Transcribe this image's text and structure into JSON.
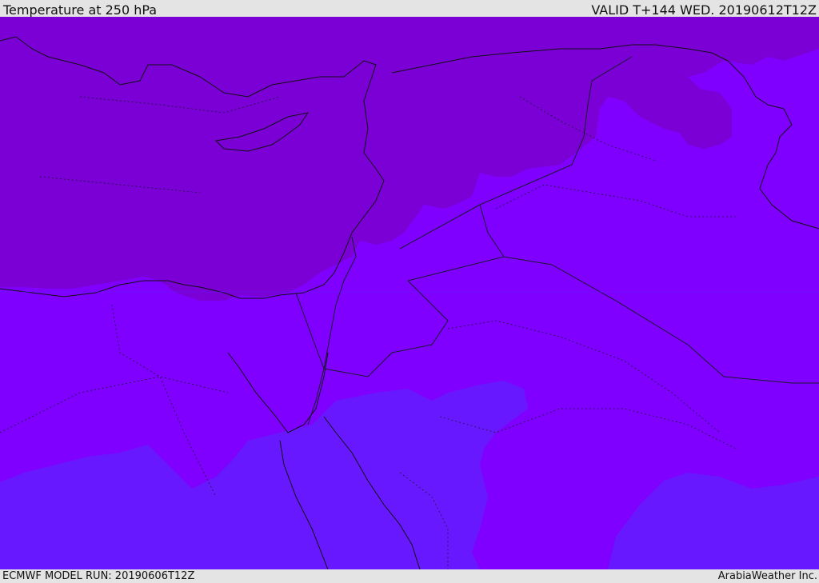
{
  "header": {
    "title": "Temperature at 250 hPa",
    "valid": "VALID T+144 WED. 20190612T12Z"
  },
  "footer": {
    "model_run": "ECMWF MODEL RUN: 20190606T12Z",
    "credit": "ArabiaWeather Inc."
  },
  "colors": {
    "band_warm": "#7a00d6",
    "band_mid": "#7f00ff",
    "band_cool": "#6818ff",
    "coastline": "#111111",
    "border": "#1a1a2e"
  }
}
